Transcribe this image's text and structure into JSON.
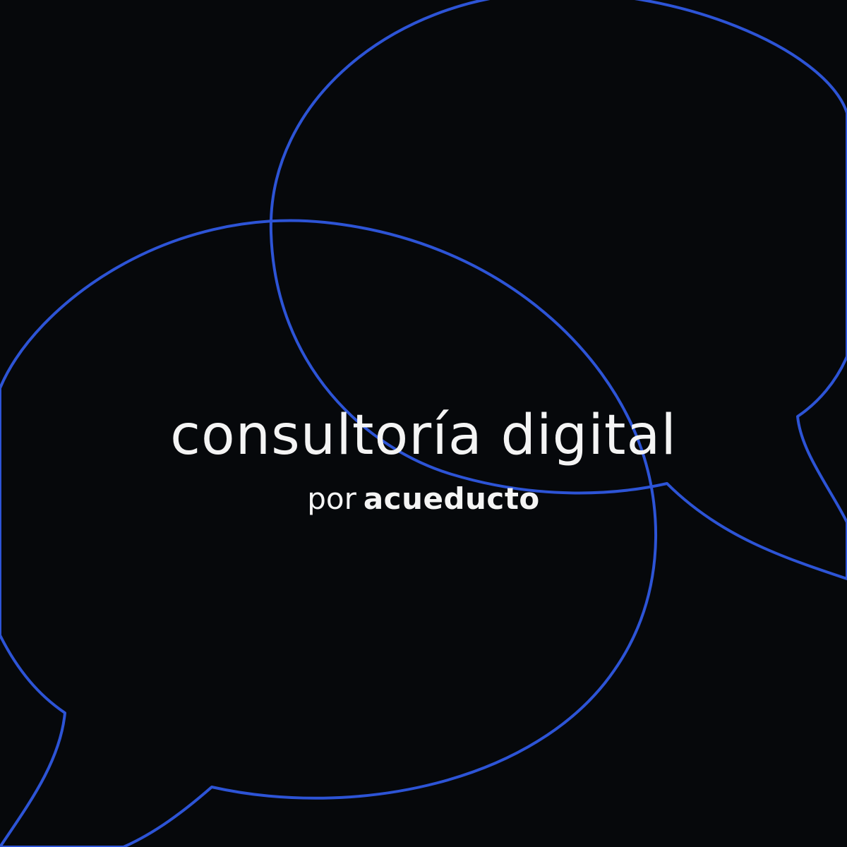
{
  "colors": {
    "background": "#06080b",
    "outline": "#2d54d6",
    "text": "#f4f4f4"
  },
  "graphics": {
    "left_bubble": "speech-bubble-outline",
    "right_bubble": "speech-bubble-outline"
  },
  "title": "consultoría digital",
  "byline": {
    "prefix": "por",
    "brand": "acueducto"
  }
}
